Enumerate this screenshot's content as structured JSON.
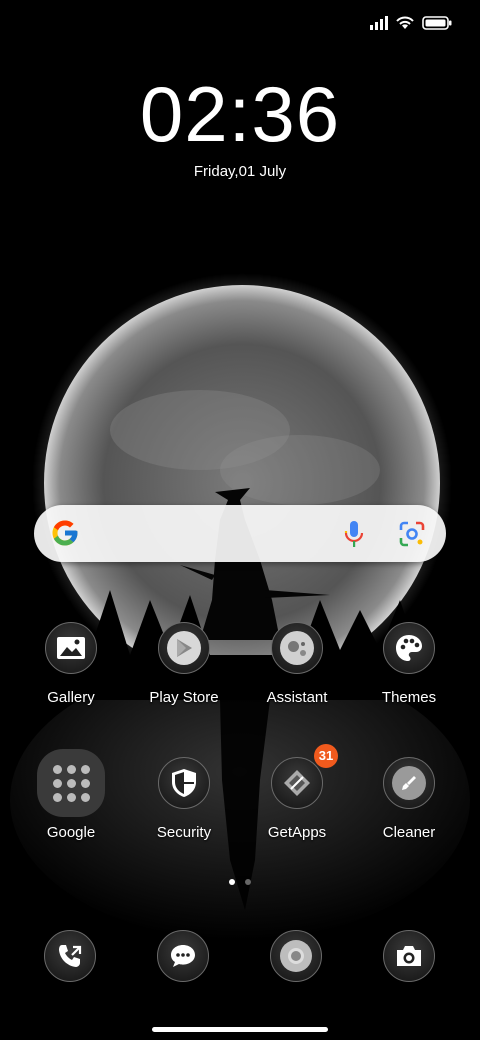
{
  "status": {
    "signal_icon": "signal-icon",
    "wifi_icon": "wifi-icon",
    "battery_icon": "battery-icon"
  },
  "clock": {
    "time": "02:36",
    "date": "Friday,01 July"
  },
  "search": {
    "google_icon": "google-g-icon",
    "mic_icon": "mic-icon",
    "lens_icon": "lens-icon"
  },
  "apps": [
    {
      "label": "Gallery",
      "icon": "gallery-icon"
    },
    {
      "label": "Play Store",
      "icon": "play-store-icon"
    },
    {
      "label": "Assistant",
      "icon": "assistant-icon"
    },
    {
      "label": "Themes",
      "icon": "themes-icon"
    },
    {
      "label": "Google",
      "icon": "folder-icon"
    },
    {
      "label": "Security",
      "icon": "security-icon"
    },
    {
      "label": "GetApps",
      "icon": "getapps-icon",
      "badge": "31"
    },
    {
      "label": "Cleaner",
      "icon": "cleaner-icon"
    }
  ],
  "dock": [
    {
      "icon": "phone-icon"
    },
    {
      "icon": "messages-icon"
    },
    {
      "icon": "chrome-icon"
    },
    {
      "icon": "camera-icon"
    }
  ],
  "pages": {
    "count": 2,
    "active": 1
  },
  "colors": {
    "badge": "#f05a1d",
    "search_bg": "#f8f8f8",
    "background": "#000000"
  }
}
